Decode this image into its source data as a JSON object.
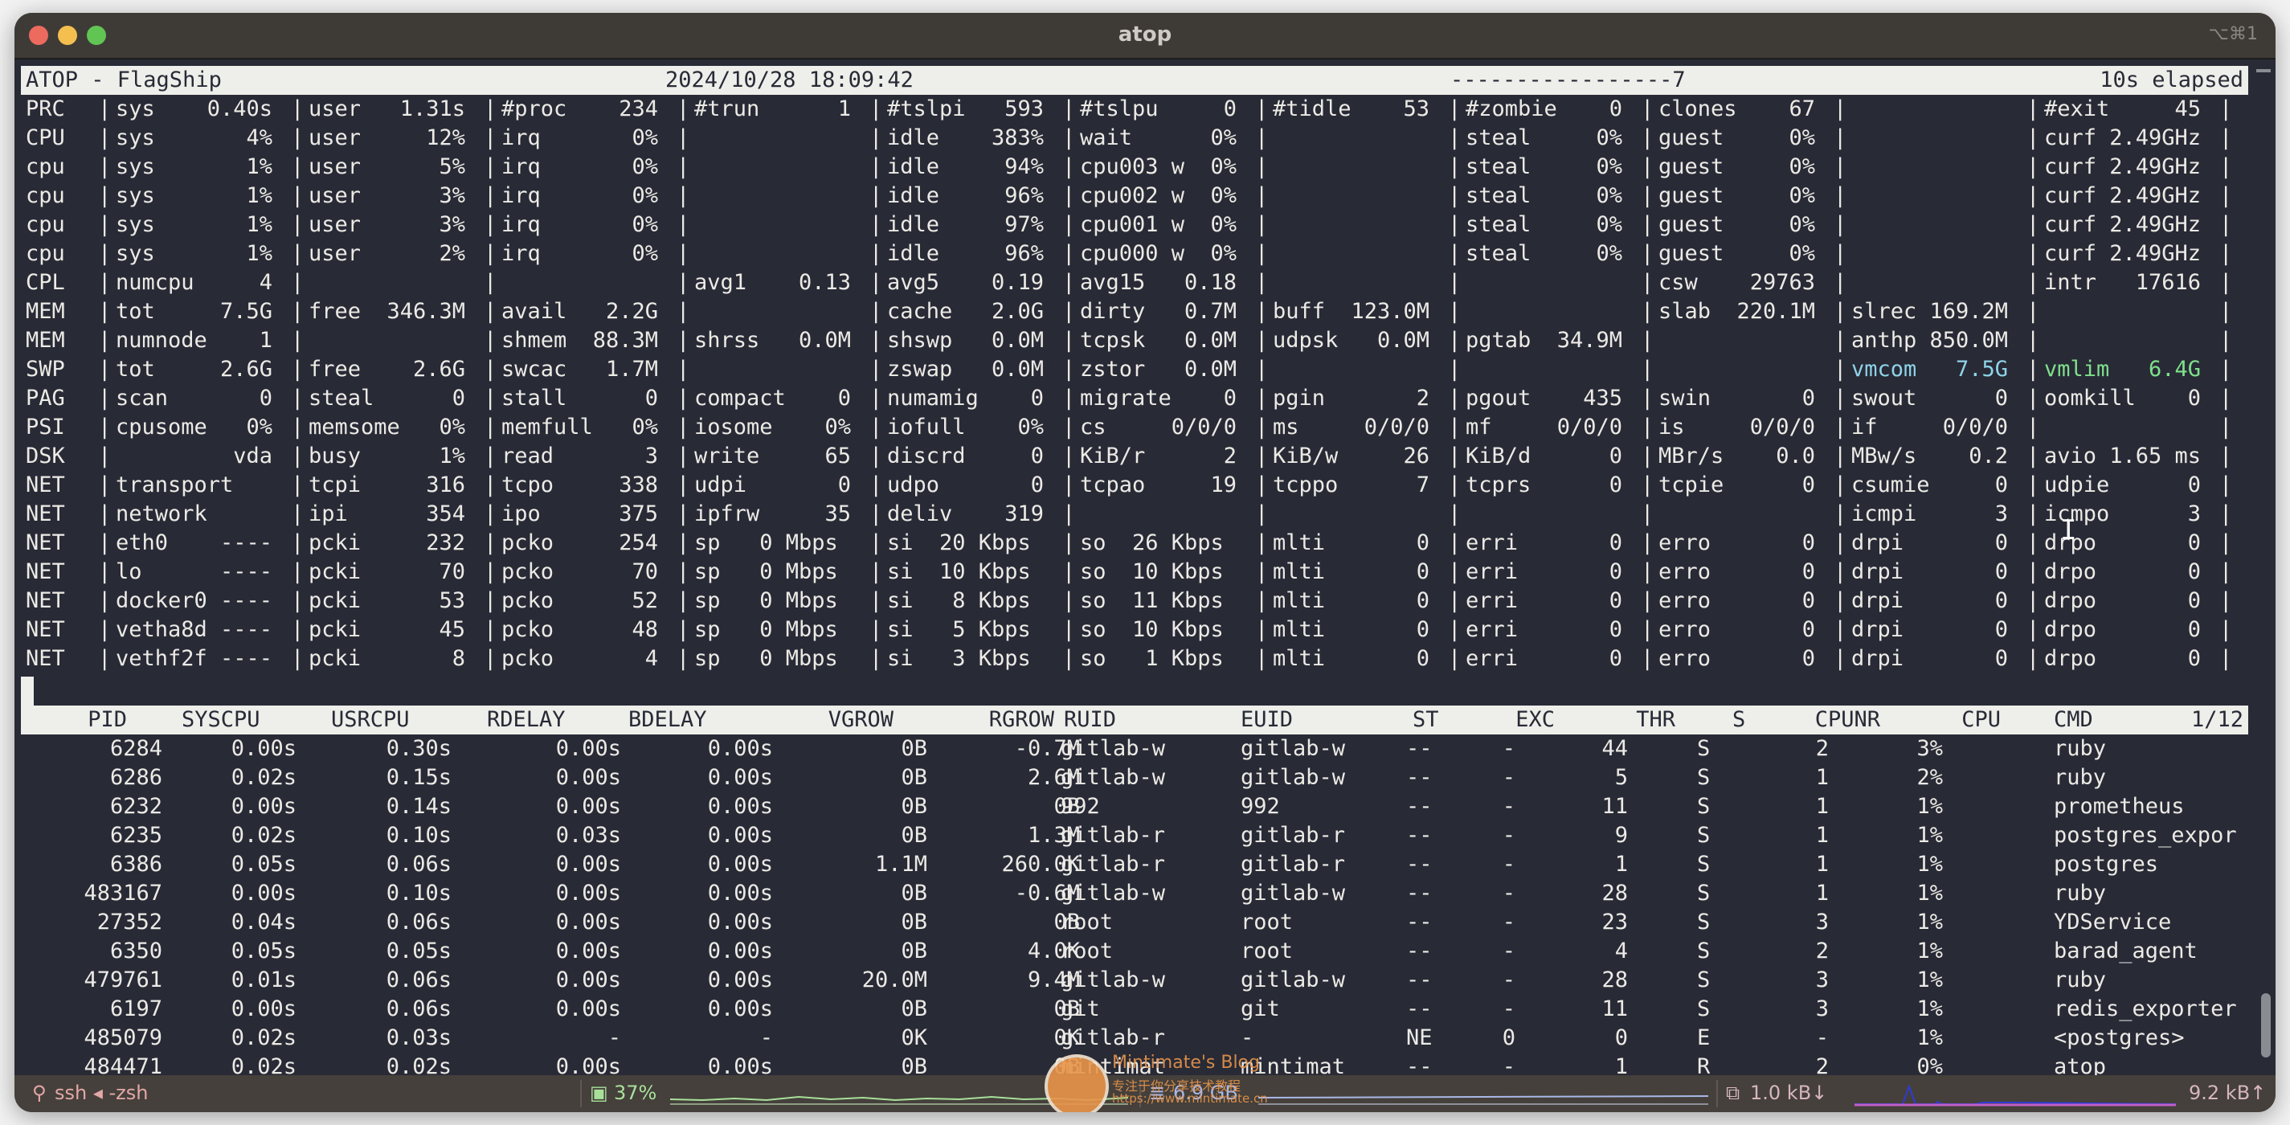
{
  "window": {
    "title": "atop",
    "shortcut": "⌥⌘1"
  },
  "header": {
    "host": "ATOP - FlagShip",
    "datetime": "2024/10/28 18:09:42",
    "flags": "-----------------7",
    "elapsed": "10s elapsed"
  },
  "system_rows": [
    {
      "label": "PRC",
      "cells": [
        "sys    0.40s",
        "user   1.31s",
        "#proc    234",
        "#trun      1",
        "#tslpi   593",
        "#tslpu     0",
        "#tidle    53",
        "#zombie    0",
        "clones    67",
        "",
        "#exit     45"
      ]
    },
    {
      "label": "CPU",
      "cells": [
        "sys       4%",
        "user     12%",
        "irq       0%",
        "",
        "idle    383%",
        "wait      0%",
        "",
        "steal     0%",
        "guest     0%",
        "",
        "curf 2.49GHz"
      ]
    },
    {
      "label": "cpu",
      "cells": [
        "sys       1%",
        "user      5%",
        "irq       0%",
        "",
        "idle     94%",
        "cpu003 w  0%",
        "",
        "steal     0%",
        "guest     0%",
        "",
        "curf 2.49GHz"
      ]
    },
    {
      "label": "cpu",
      "cells": [
        "sys       1%",
        "user      3%",
        "irq       0%",
        "",
        "idle     96%",
        "cpu002 w  0%",
        "",
        "steal     0%",
        "guest     0%",
        "",
        "curf 2.49GHz"
      ]
    },
    {
      "label": "cpu",
      "cells": [
        "sys       1%",
        "user      3%",
        "irq       0%",
        "",
        "idle     97%",
        "cpu001 w  0%",
        "",
        "steal     0%",
        "guest     0%",
        "",
        "curf 2.49GHz"
      ]
    },
    {
      "label": "cpu",
      "cells": [
        "sys       1%",
        "user      2%",
        "irq       0%",
        "",
        "idle     96%",
        "cpu000 w  0%",
        "",
        "steal     0%",
        "guest     0%",
        "",
        "curf 2.49GHz"
      ]
    },
    {
      "label": "CPL",
      "cells": [
        "numcpu     4",
        "",
        "",
        "avg1    0.13",
        "avg5    0.19",
        "avg15   0.18",
        "",
        "",
        "csw    29763",
        "",
        "intr   17616"
      ]
    },
    {
      "label": "MEM",
      "cells": [
        "tot     7.5G",
        "free  346.3M",
        "avail   2.2G",
        "",
        "cache   2.0G",
        "dirty   0.7M",
        "buff  123.0M",
        "",
        "slab  220.1M",
        "slrec 169.2M",
        ""
      ]
    },
    {
      "label": "MEM",
      "cells": [
        "numnode    1",
        "",
        "shmem  88.3M",
        "shrss   0.0M",
        "shswp   0.0M",
        "tcpsk   0.0M",
        "udpsk   0.0M",
        "pgtab  34.9M",
        "",
        "anthp 850.0M",
        ""
      ]
    },
    {
      "label": "SWP",
      "cells": [
        "tot     2.6G",
        "free    2.6G",
        "swcac   1.7M",
        "",
        "zswap   0.0M",
        "zstor   0.0M",
        "",
        "",
        "",
        "vmcom   7.5G",
        "vmlim   6.4G"
      ]
    },
    {
      "label": "PAG",
      "cells": [
        "scan       0",
        "steal      0",
        "stall      0",
        "compact    0",
        "numamig    0",
        "migrate    0",
        "pgin       2",
        "pgout    435",
        "swin       0",
        "swout      0",
        "oomkill    0"
      ]
    },
    {
      "label": "PSI",
      "cells": [
        "cpusome   0%",
        "memsome   0%",
        "memfull   0%",
        "iosome    0%",
        "iofull    0%",
        "cs     0/0/0",
        "ms     0/0/0",
        "mf     0/0/0",
        "is     0/0/0",
        "if     0/0/0",
        ""
      ]
    },
    {
      "label": "DSK",
      "cells": [
        "         vda",
        "busy      1%",
        "read       3",
        "write     65",
        "discrd     0",
        "KiB/r      2",
        "KiB/w     26",
        "KiB/d      0",
        "MBr/s    0.0",
        "MBw/s    0.2",
        "avio 1.65 ms"
      ]
    },
    {
      "label": "NET",
      "cells": [
        "transport   ",
        "tcpi     316",
        "tcpo     338",
        "udpi       0",
        "udpo       0",
        "tcpao     19",
        "tcppo      7",
        "tcprs      0",
        "tcpie      0",
        "csumie     0",
        "udpie      0"
      ]
    },
    {
      "label": "NET",
      "cells": [
        "network     ",
        "ipi      354",
        "ipo      375",
        "ipfrw     35",
        "deliv    319",
        "",
        "",
        "",
        "",
        "icmpi      3",
        "icmpo      3"
      ]
    },
    {
      "label": "NET",
      "cells": [
        "eth0    ----",
        "pcki     232",
        "pcko     254",
        "sp   0 Mbps",
        "si  20 Kbps",
        "so  26 Kbps",
        "mlti       0",
        "erri       0",
        "erro       0",
        "drpi       0",
        "drpo       0"
      ]
    },
    {
      "label": "NET",
      "cells": [
        "lo      ----",
        "pcki      70",
        "pcko      70",
        "sp   0 Mbps",
        "si  10 Kbps",
        "so  10 Kbps",
        "mlti       0",
        "erri       0",
        "erro       0",
        "drpi       0",
        "drpo       0"
      ]
    },
    {
      "label": "NET",
      "cells": [
        "docker0 ----",
        "pcki      53",
        "pcko      52",
        "sp   0 Mbps",
        "si   8 Kbps",
        "so  11 Kbps",
        "mlti       0",
        "erri       0",
        "erro       0",
        "drpi       0",
        "drpo       0"
      ]
    },
    {
      "label": "NET",
      "cells": [
        "vetha8d ----",
        "pcki      45",
        "pcko      48",
        "sp   0 Mbps",
        "si   5 Kbps",
        "so  10 Kbps",
        "mlti       0",
        "erri       0",
        "erro       0",
        "drpi       0",
        "drpo       0"
      ]
    },
    {
      "label": "NET",
      "cells": [
        "vethf2f ----",
        "pcki       8",
        "pcko       4",
        "sp   0 Mbps",
        "si   3 Kbps",
        "so   1 Kbps",
        "mlti       0",
        "erri       0",
        "erro       0",
        "drpi       0",
        "drpo       0"
      ]
    }
  ],
  "process_table": {
    "columns": [
      "PID",
      "SYSCPU",
      "USRCPU",
      "RDELAY",
      "BDELAY",
      "VGROW",
      "RGROW",
      "RUID",
      "EUID",
      "ST",
      "EXC",
      "THR",
      "S",
      "CPUNR",
      "CPU",
      "CMD"
    ],
    "page": "1/12",
    "rows": [
      [
        "6284",
        "0.00s",
        "0.30s",
        "0.00s",
        "0.00s",
        "0B",
        "-0.7M",
        "gitlab-w",
        "gitlab-w",
        "--",
        "-",
        "44",
        "S",
        "2",
        "3%",
        "ruby"
      ],
      [
        "6286",
        "0.02s",
        "0.15s",
        "0.00s",
        "0.00s",
        "0B",
        "2.6M",
        "gitlab-w",
        "gitlab-w",
        "--",
        "-",
        "5",
        "S",
        "1",
        "2%",
        "ruby"
      ],
      [
        "6232",
        "0.00s",
        "0.14s",
        "0.00s",
        "0.00s",
        "0B",
        "0B",
        "992",
        "992",
        "--",
        "-",
        "11",
        "S",
        "1",
        "1%",
        "prometheus"
      ],
      [
        "6235",
        "0.02s",
        "0.10s",
        "0.03s",
        "0.00s",
        "0B",
        "1.3M",
        "gitlab-r",
        "gitlab-r",
        "--",
        "-",
        "9",
        "S",
        "1",
        "1%",
        "postgres_expor"
      ],
      [
        "6386",
        "0.05s",
        "0.06s",
        "0.00s",
        "0.00s",
        "1.1M",
        "260.0K",
        "gitlab-r",
        "gitlab-r",
        "--",
        "-",
        "1",
        "S",
        "1",
        "1%",
        "postgres"
      ],
      [
        "483167",
        "0.00s",
        "0.10s",
        "0.00s",
        "0.00s",
        "0B",
        "-0.6M",
        "gitlab-w",
        "gitlab-w",
        "--",
        "-",
        "28",
        "S",
        "1",
        "1%",
        "ruby"
      ],
      [
        "27352",
        "0.04s",
        "0.06s",
        "0.00s",
        "0.00s",
        "0B",
        "0B",
        "root",
        "root",
        "--",
        "-",
        "23",
        "S",
        "3",
        "1%",
        "YDService"
      ],
      [
        "6350",
        "0.05s",
        "0.05s",
        "0.00s",
        "0.00s",
        "0B",
        "4.0K",
        "root",
        "root",
        "--",
        "-",
        "4",
        "S",
        "2",
        "1%",
        "barad_agent"
      ],
      [
        "479761",
        "0.01s",
        "0.06s",
        "0.00s",
        "0.00s",
        "20.0M",
        "9.4M",
        "gitlab-w",
        "gitlab-w",
        "--",
        "-",
        "28",
        "S",
        "3",
        "1%",
        "ruby"
      ],
      [
        "6197",
        "0.00s",
        "0.06s",
        "0.00s",
        "0.00s",
        "0B",
        "0B",
        "git",
        "git",
        "--",
        "-",
        "11",
        "S",
        "3",
        "1%",
        "redis_exporter"
      ],
      [
        "485079",
        "0.02s",
        "0.03s",
        "-",
        "-",
        "0K",
        "0K",
        "gitlab-r",
        "-",
        "NE",
        "0",
        "0",
        "E",
        "-",
        "1%",
        "<postgres>"
      ],
      [
        "484471",
        "0.02s",
        "0.02s",
        "0.00s",
        "0.00s",
        "0B",
        "0B",
        "mintimat",
        "mintimat",
        "--",
        "-",
        "1",
        "R",
        "2",
        "0%",
        "atop"
      ]
    ]
  },
  "statusbar": {
    "session": "ssh ◂ -zsh",
    "cpu": "37%",
    "memory": "6.9 GB",
    "net_down": "1.0 kB↓",
    "net_up": "9.2 kB↑"
  },
  "watermark": {
    "title": "Mintimate's Blog",
    "subtitle": "专注于你分享技术教程",
    "url": "https://www.mintimate.cn"
  },
  "colors": {
    "terminal_bg": "#282a36",
    "terminal_fg": "#eceae5",
    "header_bg": "#eeeeea",
    "vmcom": "#8fd3e8",
    "vmlim": "#7fe08b",
    "statusbar_bg": "#45403b",
    "session": "#e3a7a7",
    "cpu_green": "#a8e09a",
    "mem_blue": "#a9b8e8"
  }
}
